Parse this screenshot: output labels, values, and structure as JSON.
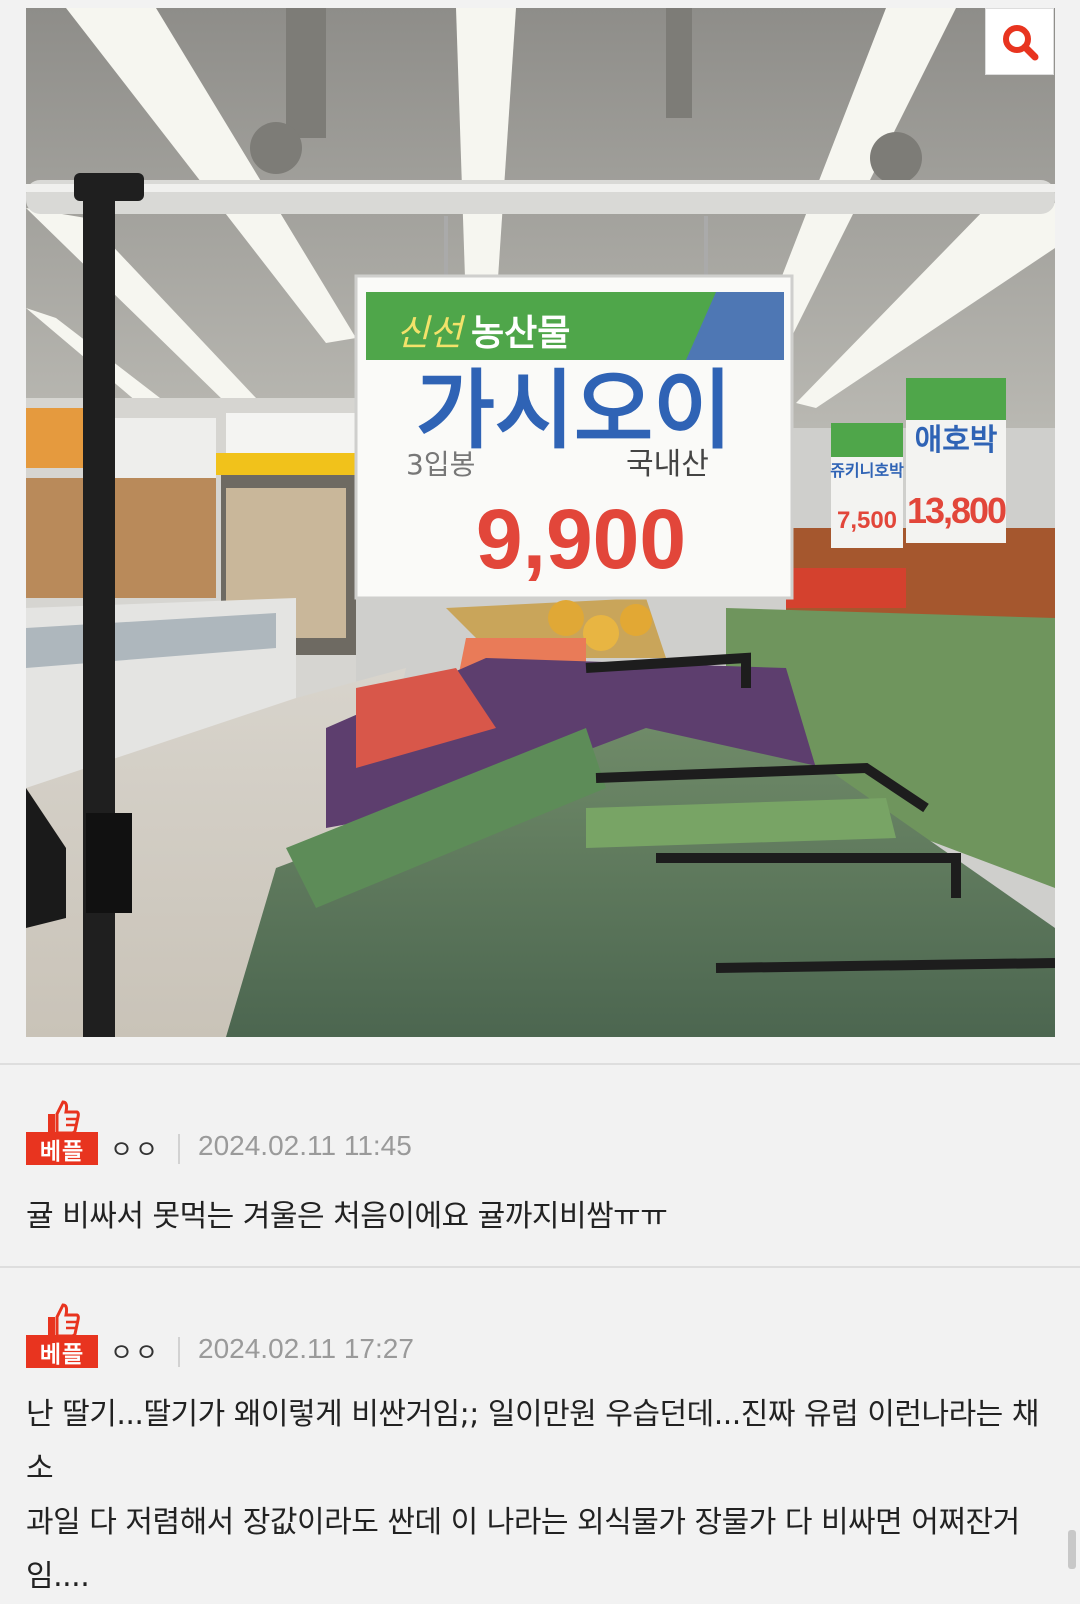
{
  "photo": {
    "sign": {
      "brand_a": "신선",
      "brand_b": "농산물",
      "product": "가시오이",
      "pack": "3입봉",
      "origin": "국내산",
      "price": "9,900"
    },
    "side_sign_a": {
      "product": "애호박",
      "price": "13,800"
    },
    "side_sign_b": {
      "product": "쥬키니호박",
      "price": "7,500"
    }
  },
  "zoom_icon": "search-icon",
  "comments": [
    {
      "badge": "베플",
      "author": "ㅇㅇ",
      "date": "2024.02.11 11:45",
      "text": "귤 비싸서 못먹는 겨울은 처음이에요 귤까지비쌈ㅠㅠ"
    },
    {
      "badge": "베플",
      "author": "ㅇㅇ",
      "date": "2024.02.11 17:27",
      "text_lines": [
        "난 딸기...딸기가 왜이렇게 비싼거임;; 일이만원 우습던데...진짜 유럽 이런나라는 채소",
        "과일 다 저렴해서 장값이라도 싼데 이 나라는 외식물가 장물가 다 비싸면 어쩌잔거",
        "임...."
      ]
    }
  ],
  "colors": {
    "badge": "#e8341f",
    "price": "#e2463a",
    "product": "#2f63b5"
  }
}
